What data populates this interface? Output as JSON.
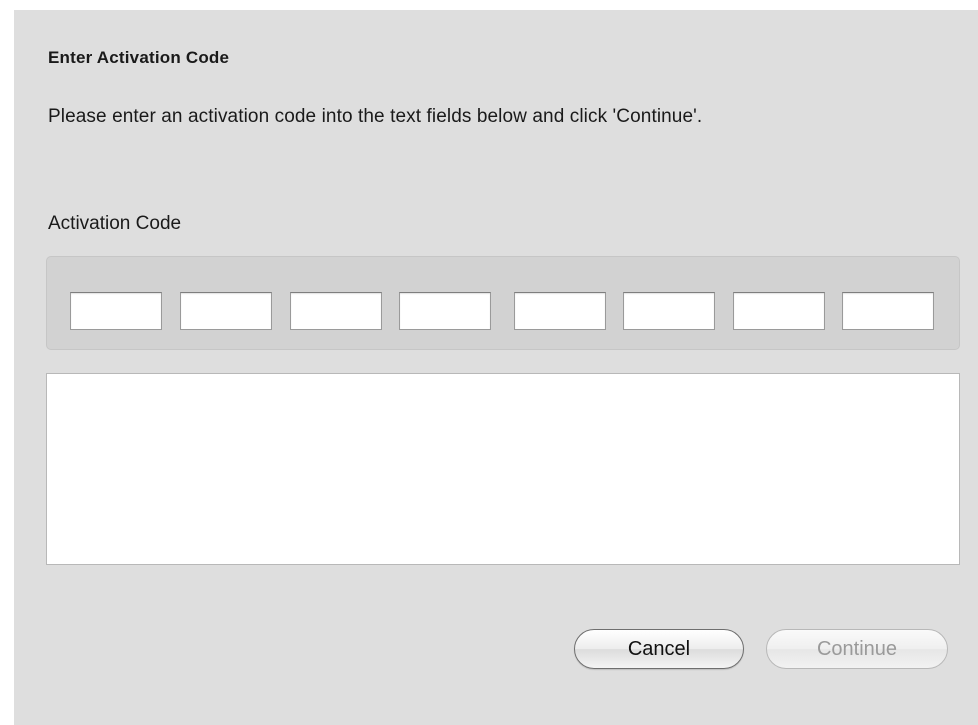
{
  "dialog": {
    "title": "Enter Activation Code",
    "message": "Please enter an activation code into the text fields below and click 'Continue'.",
    "field_label": "Activation Code",
    "code_fields": [
      {
        "value": ""
      },
      {
        "value": ""
      },
      {
        "value": ""
      },
      {
        "value": ""
      },
      {
        "value": ""
      },
      {
        "value": ""
      },
      {
        "value": ""
      },
      {
        "value": ""
      }
    ],
    "message_area_text": "",
    "buttons": {
      "cancel_label": "Cancel",
      "continue_label": "Continue",
      "continue_enabled": false
    }
  },
  "colors": {
    "dialog_background": "#dedede",
    "group_background": "#d2d2d2",
    "disabled_text": "#9a9a9a"
  }
}
